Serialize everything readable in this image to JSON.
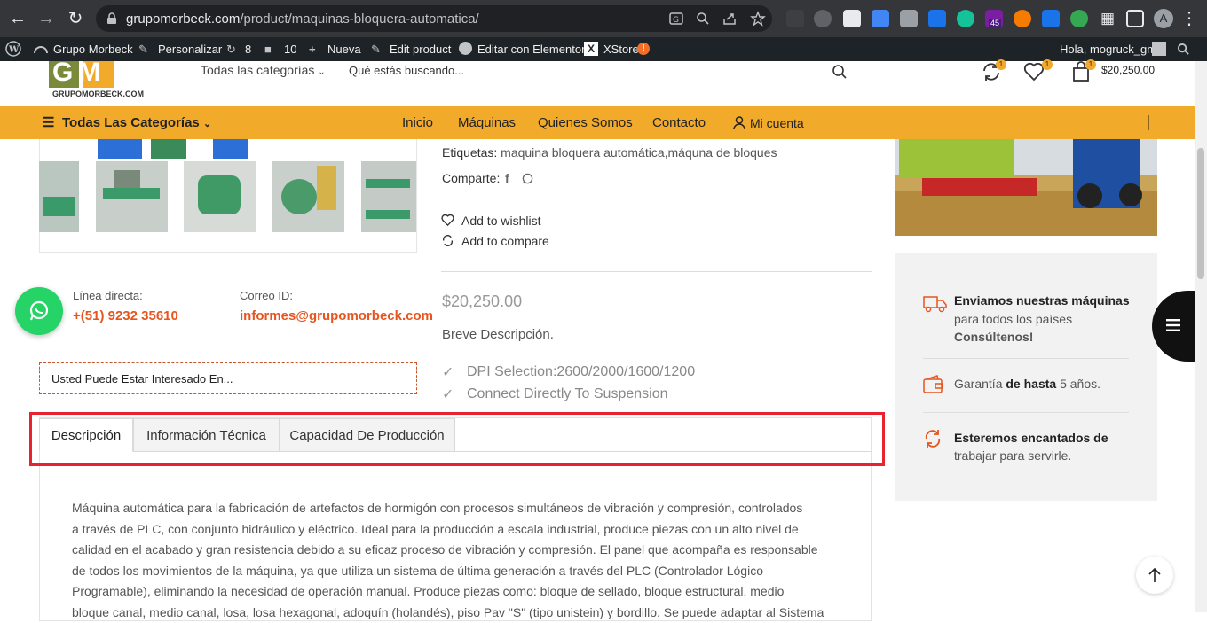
{
  "browser": {
    "url_host": "grupomorbeck.com",
    "url_path": "/product/maquinas-bloquera-automatica/",
    "ext_badge": "45",
    "profile_initial": "A"
  },
  "wpbar": {
    "site": "Grupo Morbeck",
    "customize": "Personalizar",
    "updates": "8",
    "comments": "10",
    "new": "Nueva",
    "edit": "Edit product",
    "elementor": "Editar con Elementor",
    "xstore": "XStore",
    "xstore_alert": "!",
    "greeting": "Hola, mogruck_gm"
  },
  "header": {
    "logo_text": "GRUPOMORBECK.COM",
    "logo_letters": "GM",
    "category_select": "Todas las categorías",
    "search_placeholder": "Qué estás buscando...",
    "compare_count": "1",
    "wishlist_count": "1",
    "cart_count": "1",
    "cart_total": "$20,250.00"
  },
  "nav": {
    "all_categories": "Todas Las Categorías",
    "items": [
      "Inicio",
      "Máquinas",
      "Quienes Somos",
      "Contacto"
    ],
    "account": "Mi cuenta"
  },
  "product": {
    "tags_label": "Etiquetas:",
    "tags": "maquina bloquera automática,máquna de bloques",
    "share_label": "Comparte:",
    "wishlist": "Add to wishlist",
    "compare": "Add to compare",
    "price": "$20,250.00",
    "short_desc": "Breve Descripción.",
    "features": [
      "DPI Selection:2600/2000/1600/1200",
      "Connect Directly To Suspension"
    ]
  },
  "contact": {
    "phone_label": "Línea directa:",
    "phone": "+(51) 9232 35610",
    "email_label": "Correo ID:",
    "email": "informes@grupomorbeck.com"
  },
  "interest_box": "Usted Puede Estar Interesado En...",
  "tabs": [
    "Descripción",
    "Información Técnica",
    "Capacidad De Producción"
  ],
  "description_lines": [
    "Máquina automática para la fabricación de artefactos de hormigón con procesos simultáneos de vibración y compresión, controlados",
    "a través de PLC, con conjunto hidráulico y eléctrico. Ideal para la producción a escala industrial, produce piezas con un alto nivel de",
    "calidad en el acabado y gran resistencia debido a su eficaz proceso de vibración y compresión. El panel que acompaña es responsable",
    "de todos los movimientos de la máquina, ya que utiliza un sistema de última generación a través del PLC (Controlador Lógico",
    "Programable), eliminando la necesidad de operación manual. Produce piezas como: bloque de sellado, bloque estructural, medio",
    "bloque canal, medio canal, losa, losa hexagonal, adoquín (holandés), piso Pav \"S\" (tipo unistein) y bordillo. Se puede adaptar al Sistema"
  ],
  "sidebar": {
    "ship_title": "Enviamos nuestras máquinas",
    "ship_sub": "para todos los países",
    "ship_cta": "Consúltenos!",
    "warranty_pre": "Garantía",
    "warranty_bold": "de hasta",
    "warranty_post": "5 años.",
    "serve_title": "Esteremos encantados de",
    "serve_sub": "trabajar para servirle."
  },
  "colors": {
    "accent": "#f2aa2a",
    "orange_text": "#e8541e",
    "highlight": "#e8222e",
    "whatsapp": "#25d366"
  }
}
